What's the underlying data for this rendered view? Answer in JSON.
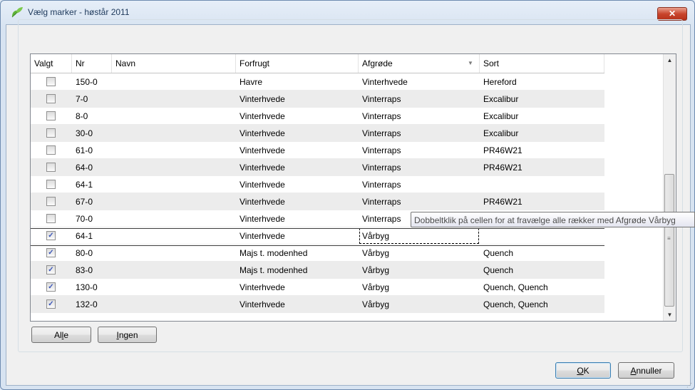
{
  "window": {
    "title": "Vælg marker - høstår 2011",
    "close_label": "✕"
  },
  "grid": {
    "columns": [
      {
        "key": "valgt",
        "label": "Valgt"
      },
      {
        "key": "nr",
        "label": "Nr"
      },
      {
        "key": "navn",
        "label": "Navn"
      },
      {
        "key": "forfrugt",
        "label": "Forfrugt"
      },
      {
        "key": "afgrode",
        "label": "Afgrøde"
      },
      {
        "key": "sort",
        "label": "Sort"
      }
    ],
    "sorted_column": "Afgrøde",
    "rows": [
      {
        "checked": false,
        "nr": "150-0",
        "navn": "",
        "forfrugt": "Havre",
        "afgrode": "Vinterhvede",
        "sort": "Hereford"
      },
      {
        "checked": false,
        "nr": "7-0",
        "navn": "",
        "forfrugt": "Vinterhvede",
        "afgrode": "Vinterraps",
        "sort": "Excalibur"
      },
      {
        "checked": false,
        "nr": "8-0",
        "navn": "",
        "forfrugt": "Vinterhvede",
        "afgrode": "Vinterraps",
        "sort": "Excalibur"
      },
      {
        "checked": false,
        "nr": "30-0",
        "navn": "",
        "forfrugt": "Vinterhvede",
        "afgrode": "Vinterraps",
        "sort": "Excalibur"
      },
      {
        "checked": false,
        "nr": "61-0",
        "navn": "",
        "forfrugt": "Vinterhvede",
        "afgrode": "Vinterraps",
        "sort": "PR46W21"
      },
      {
        "checked": false,
        "nr": "64-0",
        "navn": "",
        "forfrugt": "Vinterhvede",
        "afgrode": "Vinterraps",
        "sort": "PR46W21"
      },
      {
        "checked": false,
        "nr": "64-1",
        "navn": "",
        "forfrugt": "Vinterhvede",
        "afgrode": "Vinterraps",
        "sort": ""
      },
      {
        "checked": false,
        "nr": "67-0",
        "navn": "",
        "forfrugt": "Vinterhvede",
        "afgrode": "Vinterraps",
        "sort": "PR46W21"
      },
      {
        "checked": false,
        "nr": "70-0",
        "navn": "",
        "forfrugt": "Vinterhvede",
        "afgrode": "Vinterraps",
        "sort": ""
      },
      {
        "checked": true,
        "nr": "64-1",
        "navn": "",
        "forfrugt": "Vinterhvede",
        "afgrode": "Vårbyg",
        "sort": "",
        "current": true
      },
      {
        "checked": true,
        "nr": "80-0",
        "navn": "",
        "forfrugt": "Majs t. modenhed",
        "afgrode": "Vårbyg",
        "sort": "Quench"
      },
      {
        "checked": true,
        "nr": "83-0",
        "navn": "",
        "forfrugt": "Majs t. modenhed",
        "afgrode": "Vårbyg",
        "sort": "Quench"
      },
      {
        "checked": true,
        "nr": "130-0",
        "navn": "",
        "forfrugt": "Vinterhvede",
        "afgrode": "Vårbyg",
        "sort": "Quench, Quench"
      },
      {
        "checked": true,
        "nr": "132-0",
        "navn": "",
        "forfrugt": "Vinterhvede",
        "afgrode": "Vårbyg",
        "sort": "Quench, Quench"
      }
    ]
  },
  "tooltip": "Dobbeltklik på cellen for at fravælge alle rækker med Afgrøde Vårbyg",
  "buttons": {
    "alle_pre": "Al",
    "alle_mnemonic": "l",
    "alle_post": "e",
    "ingen_pre": "",
    "ingen_mnemonic": "I",
    "ingen_post": "ngen",
    "ok_pre": "",
    "ok_mnemonic": "O",
    "ok_post": "K",
    "annuller_pre": "",
    "annuller_mnemonic": "A",
    "annuller_post": "nnuller"
  },
  "icons": {
    "app": "leaf-icon",
    "checkmark": "✓",
    "scroll_up": "▲",
    "scroll_down": "▼",
    "sort_desc": "▼"
  },
  "colors": {
    "title_text": "#1e395b",
    "close_button": "#c9452c",
    "checkbox_mark": "#3b56b8",
    "alt_row": "#ececec"
  }
}
